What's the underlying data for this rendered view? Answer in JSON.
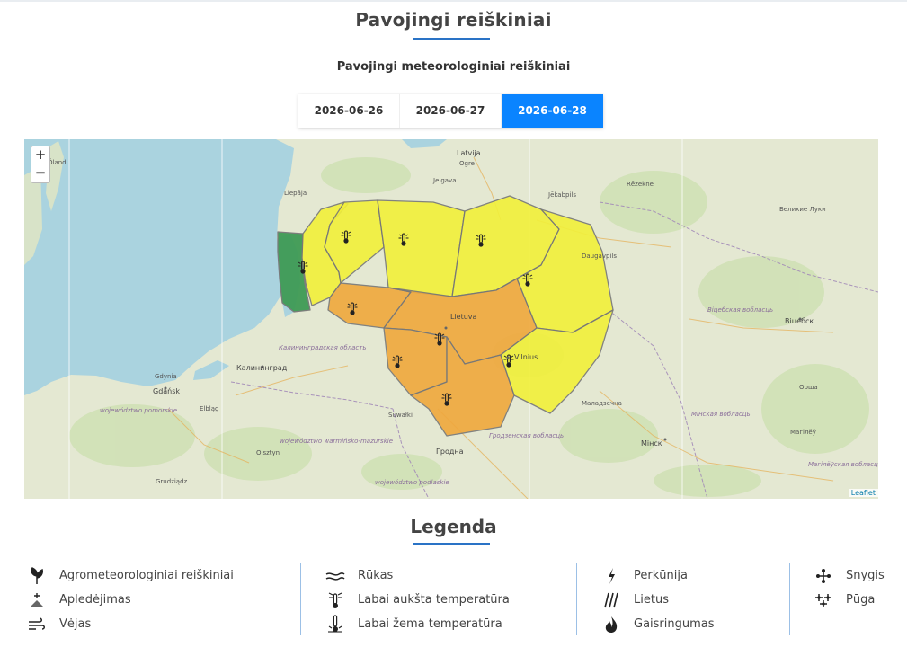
{
  "page": {
    "title": "Pavojingi reiškiniai",
    "subtitle": "Pavojingi meteorologiniai reiškiniai"
  },
  "tabs": [
    {
      "label": "2026-06-26",
      "active": false
    },
    {
      "label": "2026-06-27",
      "active": false
    },
    {
      "label": "2026-06-28",
      "active": true
    }
  ],
  "map": {
    "zoom_in": "+",
    "zoom_out": "−",
    "attribution": "Leaflet",
    "labels": {
      "latvija": "Latvija",
      "ogre": "Ogre",
      "jelgava": "Jelgava",
      "jekabpils": "Jēkabpils",
      "liepaja": "Liepāja",
      "daugavpils": "Daugavpils",
      "rezekne": "Rēzekne",
      "velikie_luki": "Великие Луки",
      "lietuva": "Lietuva",
      "vilnius": "Vilnius",
      "kaliningrad": "Калининград",
      "gdansk": "Gdańsk",
      "gdynia": "Gdynia",
      "elblag": "Elbląg",
      "suwalki": "Suwałki",
      "grodno": "Гродна",
      "minsk": "Мінск",
      "vitebsk": "Віцебск",
      "orsha": "Орша",
      "mogilev": "Магілёў",
      "molodechno": "Маладзечна",
      "olsztyn": "Olsztyn",
      "grudziadz": "Grudziądz",
      "oland": "Öland",
      "kal_obl": "Калининградская область",
      "pomorskie": "województwo pomorskie",
      "warm_maz": "województwo warmińsko-mazurskie",
      "podlaskie": "województwo podlaskie",
      "grodno_obl": "Гродзенская вобласць",
      "vitebsk_obl": "Віцебская вобласць",
      "minsk_obl": "Мінская вобласць",
      "mogilev_obl": "Магілёўская вобласць"
    }
  },
  "legend": {
    "title": "Legenda",
    "columns": [
      [
        {
          "icon": "agrometeo-icon",
          "label": "Agrometeorologiniai reiškiniai"
        },
        {
          "icon": "icing-icon",
          "label": "Apledėjimas"
        },
        {
          "icon": "wind-icon",
          "label": "Vėjas"
        }
      ],
      [
        {
          "icon": "fog-icon",
          "label": "Rūkas"
        },
        {
          "icon": "high-temperature-icon",
          "label": "Labai aukšta temperatūra"
        },
        {
          "icon": "low-temperature-icon",
          "label": "Labai žema temperatūra"
        }
      ],
      [
        {
          "icon": "thunder-icon",
          "label": "Perkūnija"
        },
        {
          "icon": "rain-icon",
          "label": "Lietus"
        },
        {
          "icon": "fire-icon",
          "label": "Gaisringumas"
        }
      ],
      [
        {
          "icon": "snow-icon",
          "label": "Snygis"
        },
        {
          "icon": "blizzard-icon",
          "label": "Pūga"
        }
      ]
    ]
  },
  "colors": {
    "active_tab": "#0a84ff",
    "accent_line": "#2a73c6",
    "warning_yellow": "#f2f03a",
    "warning_orange": "#f0a83c",
    "warning_green": "#3f9b55",
    "sea": "#aad3df",
    "land": "#e6e9d6"
  }
}
